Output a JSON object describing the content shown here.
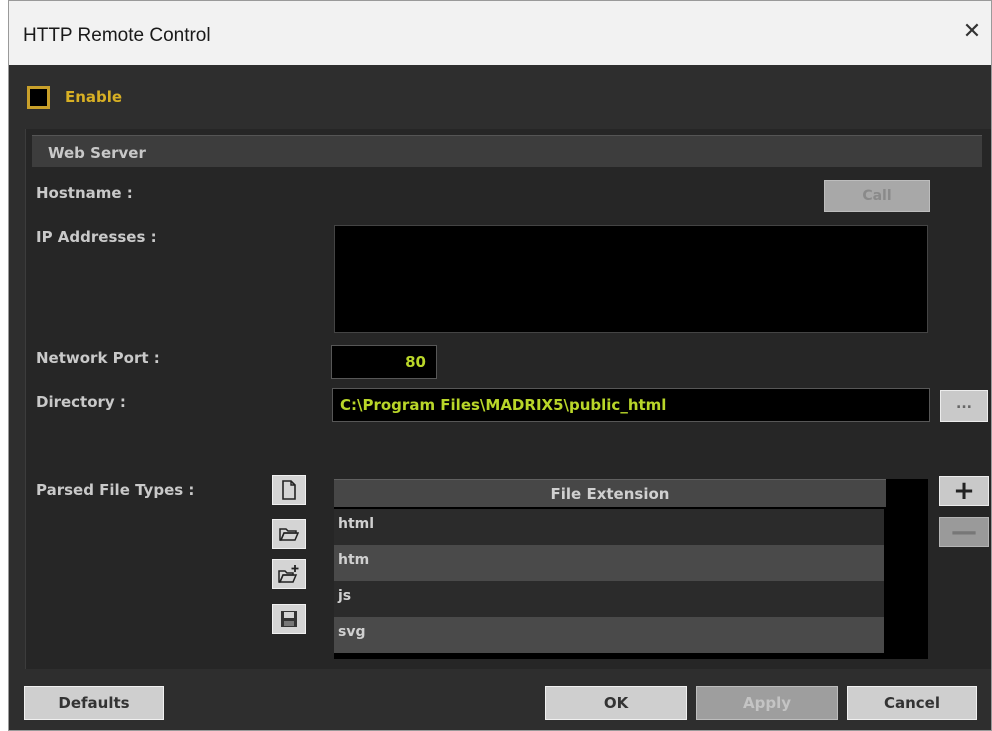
{
  "window": {
    "title": "HTTP Remote Control",
    "close_glyph": "✕"
  },
  "enable": {
    "label": "Enable",
    "checked": false
  },
  "web_server": {
    "header": "Web Server",
    "hostname_label": "Hostname :",
    "call_button": "Call",
    "ip_label": "IP Addresses :",
    "ip_addresses": [],
    "port_label": "Network Port :",
    "port_value": "80",
    "directory_label": "Directory :",
    "directory_value": "C:\\Program Files\\MADRIX5\\public_html",
    "browse_button": "...",
    "parsed_label": "Parsed File Types :",
    "icons": [
      "new-file-icon",
      "open-folder-icon",
      "add-folder-icon",
      "save-icon"
    ],
    "table_header": "File Extension",
    "extensions": [
      "html",
      "htm",
      "js",
      "svg"
    ],
    "add_glyph": "+",
    "remove_glyph": "—"
  },
  "buttons": {
    "defaults": "Defaults",
    "ok": "OK",
    "apply": "Apply",
    "cancel": "Cancel"
  },
  "colors": {
    "accent_yellow": "#d8b024",
    "value_green": "#b9d629",
    "panel": "#262626"
  }
}
